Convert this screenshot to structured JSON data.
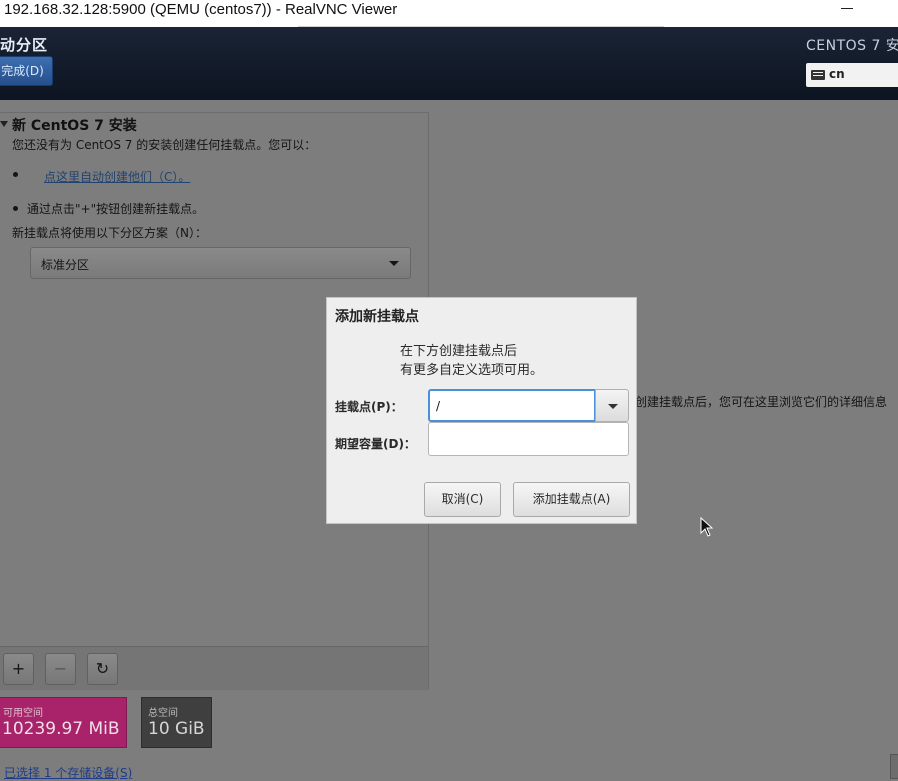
{
  "window": {
    "title": "192.168.32.128:5900 (QEMU (centos7)) - RealVNC Viewer"
  },
  "header": {
    "section_title": "动分区",
    "done_label": "完成(D)",
    "product_title": "CENTOS 7 安",
    "keyboard_layout": "cn"
  },
  "left_panel": {
    "install_title": "新 CentOS 7 安装",
    "no_mountpoints_text": "您还没有为 CentOS 7 的安装创建任何挂载点。您可以：",
    "auto_create_link": "点这里自动创建他们（C）。",
    "manual_create_text": "通过点击\"+\"按钮创建新挂载点。",
    "scheme_label": "新挂载点将使用以下分区方案（N）：",
    "scheme_value": "标准分区",
    "toolbar": {
      "add": "+",
      "remove": "−",
      "refresh": "↻"
    }
  },
  "space": {
    "available_label": "可用空间",
    "available_value": "10239.97 MiB",
    "total_label": "总空间",
    "total_value": "10 GiB",
    "storage_link": "已选择 1 个存储设备(S)"
  },
  "right_panel": {
    "hint_text": "创建挂载点后，您可在这里浏览它们的详细信息"
  },
  "dialog": {
    "title": "添加新挂载点",
    "description_line1": "在下方创建挂载点后",
    "description_line2": "有更多自定义选项可用。",
    "mount_point_label": "挂载点(P)：",
    "mount_point_value": "/",
    "capacity_label": "期望容量(D)：",
    "capacity_value": "",
    "cancel_label": "取消(C)",
    "add_label": "添加挂载点(A)"
  },
  "colors": {
    "header_bg": "#111a29",
    "available_tile": "#a8236a",
    "total_tile": "#3f3f3f",
    "focus_blue": "#4a90d9"
  },
  "icons": [
    "keyboard-icon",
    "dropdown-caret-icon",
    "add-icon",
    "remove-icon",
    "refresh-icon",
    "expander-triangle-icon",
    "mouse-cursor-icon",
    "minimize-icon"
  ]
}
